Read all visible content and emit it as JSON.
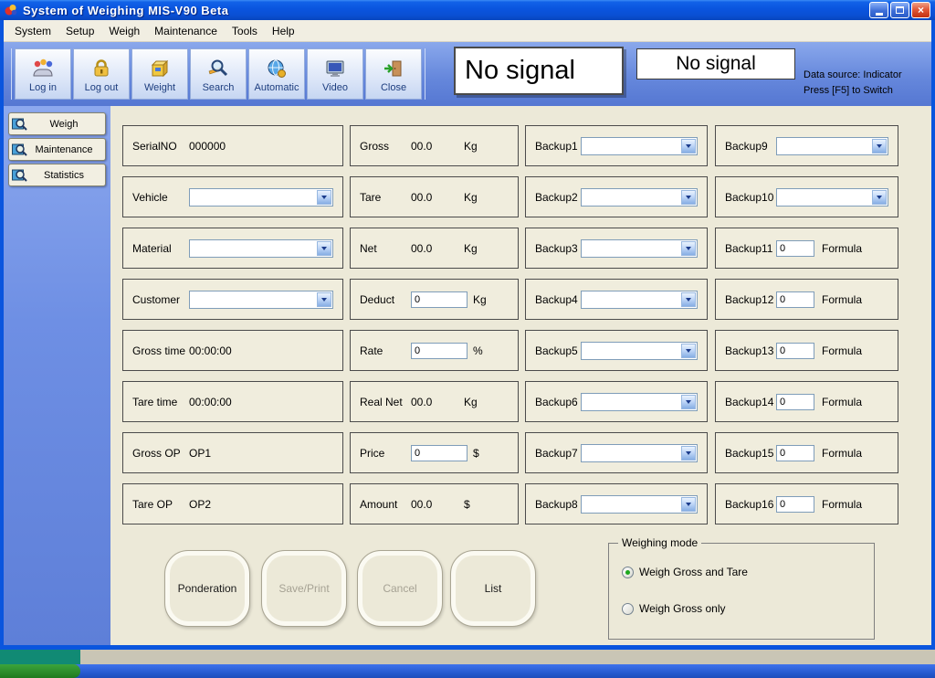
{
  "window": {
    "title": "System of Weighing MIS-V90 Beta",
    "close_glyph": "×"
  },
  "menu": {
    "items": [
      "System",
      "Setup",
      "Weigh",
      "Maintenance",
      "Tools",
      "Help"
    ]
  },
  "toolbar": {
    "buttons": [
      {
        "label": "Log in"
      },
      {
        "label": "Log out"
      },
      {
        "label": "Weight"
      },
      {
        "label": "Search"
      },
      {
        "label": "Automatic"
      },
      {
        "label": "Video"
      },
      {
        "label": "Close"
      }
    ],
    "display_primary": "No signal",
    "display_secondary": "No signal",
    "datasource_line1": "Data source: Indicator",
    "datasource_line2": "Press  [F5] to Switch"
  },
  "sidebar": {
    "items": [
      {
        "label": "Weigh"
      },
      {
        "label": "Maintenance"
      },
      {
        "label": "Statistics"
      }
    ]
  },
  "form": {
    "col1": [
      {
        "label": "SerialNO",
        "value": "000000"
      },
      {
        "label": "Vehicle"
      },
      {
        "label": "Material"
      },
      {
        "label": "Customer"
      },
      {
        "label": "Gross time",
        "value": "00:00:00"
      },
      {
        "label": "Tare time",
        "value": "00:00:00"
      },
      {
        "label": "Gross OP",
        "value": "OP1"
      },
      {
        "label": "Tare OP",
        "value": "OP2"
      }
    ],
    "col2": [
      {
        "label": "Gross",
        "value": "00.0",
        "unit": "Kg"
      },
      {
        "label": "Tare",
        "value": "00.0",
        "unit": "Kg"
      },
      {
        "label": "Net",
        "value": "00.0",
        "unit": "Kg"
      },
      {
        "label": "Deduct",
        "value": "0",
        "unit": "Kg"
      },
      {
        "label": "Rate",
        "value": "0",
        "unit": "%"
      },
      {
        "label": "Real Net",
        "value": "00.0",
        "unit": "Kg"
      },
      {
        "label": "Price",
        "value": "0",
        "unit": "$"
      },
      {
        "label": "Amount",
        "value": "00.0",
        "unit": "$"
      }
    ],
    "col3": [
      {
        "label": "Backup1"
      },
      {
        "label": "Backup2"
      },
      {
        "label": "Backup3"
      },
      {
        "label": "Backup4"
      },
      {
        "label": "Backup5"
      },
      {
        "label": "Backup6"
      },
      {
        "label": "Backup7"
      },
      {
        "label": "Backup8"
      }
    ],
    "col4": [
      {
        "label": "Backup9"
      },
      {
        "label": "Backup10"
      },
      {
        "label": "Backup11",
        "value": "0",
        "suffix": "Formula"
      },
      {
        "label": "Backup12",
        "value": "0",
        "suffix": "Formula"
      },
      {
        "label": "Backup13",
        "value": "0",
        "suffix": "Formula"
      },
      {
        "label": "Backup14",
        "value": "0",
        "suffix": "Formula"
      },
      {
        "label": "Backup15",
        "value": "0",
        "suffix": "Formula"
      },
      {
        "label": "Backup16",
        "value": "0",
        "suffix": "Formula"
      }
    ]
  },
  "actions": {
    "ponderation": "Ponderation",
    "save_print": "Save/Print",
    "cancel": "Cancel",
    "list": "List"
  },
  "weighing_mode": {
    "title": "Weighing mode",
    "option1": "Weigh Gross and Tare",
    "option2": "Weigh Gross only"
  }
}
